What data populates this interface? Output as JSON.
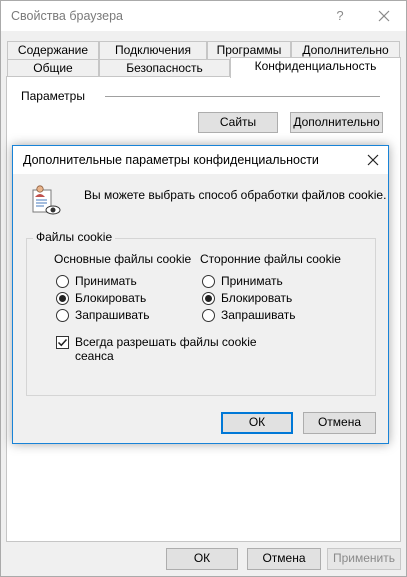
{
  "window": {
    "title": "Свойства браузера",
    "help": "?",
    "close": "✕"
  },
  "tabs": {
    "row1": [
      "Содержание",
      "Подключения",
      "Программы",
      "Дополнительно"
    ],
    "row2": [
      "Общие",
      "Безопасность",
      "Конфиденциальность"
    ],
    "active": "Конфиденциальность"
  },
  "privacy": {
    "params_label": "Параметры",
    "sites_button": "Сайты",
    "advanced_button": "Дополнительно"
  },
  "dialog": {
    "title": "Дополнительные параметры конфиденциальности",
    "close": "✕",
    "description": "Вы можете выбрать способ обработки файлов cookie.",
    "group_label": "Файлы cookie",
    "first_party": {
      "heading": "Основные файлы cookie",
      "options": [
        "Принимать",
        "Блокировать",
        "Запрашивать"
      ],
      "selected": "Блокировать"
    },
    "third_party": {
      "heading": "Сторонние файлы cookie",
      "options": [
        "Принимать",
        "Блокировать",
        "Запрашивать"
      ],
      "selected": "Блокировать"
    },
    "session_cookies": {
      "label": "Всегда разрешать файлы cookie сеанса",
      "checked": true
    },
    "ok": "ОК",
    "cancel": "Отмена"
  },
  "footer": {
    "ok": "ОК",
    "cancel": "Отмена",
    "apply": "Применить",
    "apply_disabled": true
  },
  "colors": {
    "focus_border": "#0078d7",
    "dialog_border": "#1883d7",
    "window_bg": "#f0f0f0"
  }
}
